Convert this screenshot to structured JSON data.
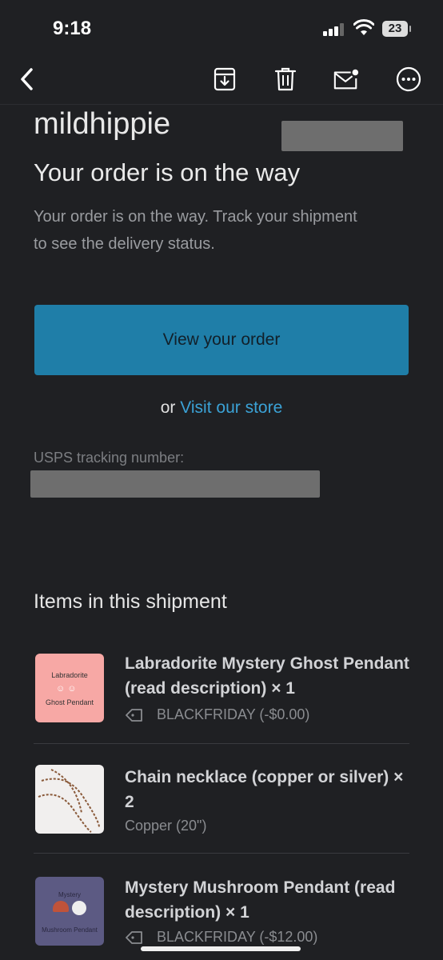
{
  "status": {
    "time": "9:18",
    "battery": "23"
  },
  "toolbar": {
    "back_icon": "chevron-left-icon",
    "archive_icon": "archive-icon",
    "delete_icon": "trash-icon",
    "mark_unread_icon": "mail-unread-icon",
    "more_icon": "more-icon"
  },
  "email": {
    "brand": "mildhippie",
    "headline": "Your order is on the way",
    "description": "Your order is on the way. Track your shipment to see the delivery status.",
    "cta_label": "View your order",
    "or_text": "or",
    "store_link": "Visit our store",
    "tracking_label": "USPS tracking number:",
    "items_title": "Items in this shipment"
  },
  "items": [
    {
      "title": "Labradorite Mystery Ghost Pendant (read description) × 1",
      "sub": "BLACKFRIDAY (-$0.00)",
      "thumb_line1": "Labradorite",
      "thumb_line2": "Ghost Pendant"
    },
    {
      "title": "Chain necklace (copper or silver) × 2",
      "sub": "Copper (20\")"
    },
    {
      "title": "Mystery Mushroom Pendant (read description) × 1",
      "sub": "BLACKFRIDAY (-$12.00)",
      "thumb_line1": "Mystery",
      "thumb_line2": "Mushroom Pendant"
    }
  ],
  "colors": {
    "accent": "#1f7ea8",
    "link": "#3ba2d6",
    "background": "#1f2023"
  }
}
